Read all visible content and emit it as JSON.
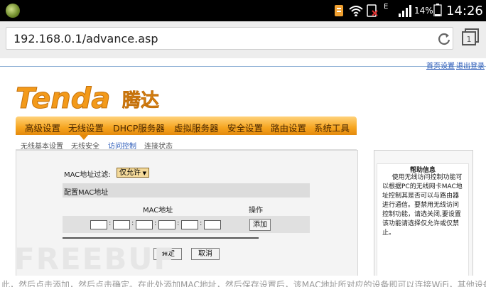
{
  "status_bar": {
    "time": "14:26",
    "battery": "14%",
    "network_letter": "E",
    "icons": [
      "app-launcher-icon",
      "notification-icon",
      "wifi-icon",
      "no-sim-icon",
      "signal-icon",
      "battery-icon"
    ]
  },
  "browser": {
    "url": "192.168.0.1/advance.asp",
    "tab_count": "1",
    "icons": [
      "reload-icon",
      "tabs-icon"
    ]
  },
  "top_links": {
    "home": "首页设置",
    "logout": "退出登录"
  },
  "brand": {
    "logo_latin": "Tenda",
    "logo_cn": "腾达",
    "accent_color": "#f6a520",
    "nav_text_color": "#4a2800",
    "link_color": "#2a5ab8"
  },
  "nav": {
    "items": [
      "高级设置",
      "无线设置",
      "DHCP服务器",
      "虚拟服务器",
      "安全设置",
      "路由设置",
      "系统工具"
    ]
  },
  "subnav": {
    "items": [
      "无线基本设置",
      "无线安全",
      "访问控制",
      "连接状态"
    ],
    "active": "访问控制"
  },
  "form": {
    "mac_filter_label": "MAC地址过滤:",
    "mac_filter_value": "仅允许",
    "config_mac_label": "配置MAC地址",
    "mac_column": "MAC地址",
    "action_column": "操作",
    "add_button": "添加",
    "mac_separator": ":",
    "confirm_button": "确定",
    "cancel_button": "取消"
  },
  "help": {
    "title": "帮助信息",
    "body": "使用无线访问控制功能可以根据PC的无线网卡MAC地址控制其是否可以与路由器进行通信。要禁用无线访问控制功能，请选关闭,要设置该功能请选择仅允许或仅禁止。"
  },
  "watermark": "FREEBUF",
  "bottom_text": "此，然后点击添加，然后点击确定。在此处添加MAC地址，然后保存设置后，该MAC地址所对应的设备即可以连接WiFi，其他设备则无法连接。"
}
